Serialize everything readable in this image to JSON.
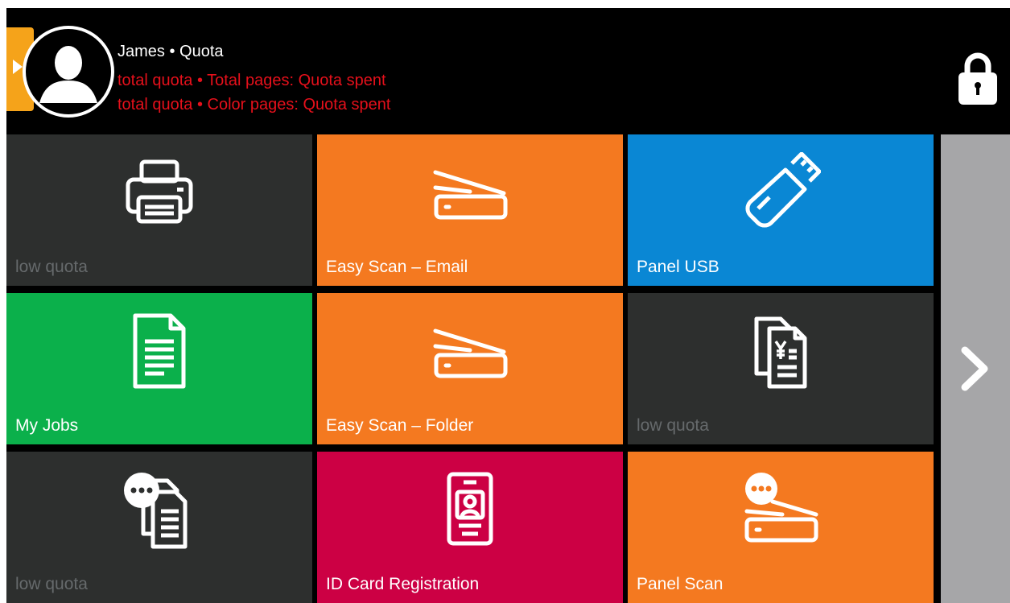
{
  "header": {
    "user_line": "James • Quota",
    "quota_lines": [
      "total quota  • Total pages: Quota spent",
      "total quota  • Color pages: Quota spent"
    ],
    "icons": [
      "avatar-icon",
      "lock-icon",
      "side-tab-arrow-icon"
    ]
  },
  "tiles": [
    {
      "label": "low quota",
      "icon": "printer-icon",
      "color": "#2d2f2e",
      "enabled": false
    },
    {
      "label": "Easy Scan – Email",
      "icon": "scanner-icon",
      "color": "#f47920",
      "enabled": true
    },
    {
      "label": "Panel USB",
      "icon": "usb-drive-icon",
      "color": "#0a87d4",
      "enabled": true
    },
    {
      "label": "My Jobs",
      "icon": "document-icon",
      "color": "#0bb04b",
      "enabled": true
    },
    {
      "label": "Easy Scan – Folder",
      "icon": "scanner-icon",
      "color": "#f47920",
      "enabled": true
    },
    {
      "label": "low quota",
      "icon": "yen-documents-icon",
      "color": "#2d2f2e",
      "enabled": false
    },
    {
      "label": "low quota",
      "icon": "chat-documents-icon",
      "color": "#2d2f2e",
      "enabled": false
    },
    {
      "label": "ID Card Registration",
      "icon": "id-card-icon",
      "color": "#cc0044",
      "enabled": true
    },
    {
      "label": "Panel Scan",
      "icon": "chat-scanner-icon",
      "color": "#f47920",
      "enabled": true
    }
  ],
  "navigation": {
    "next_icon": "chevron-right-icon",
    "panel_color": "#a6a6a8"
  }
}
